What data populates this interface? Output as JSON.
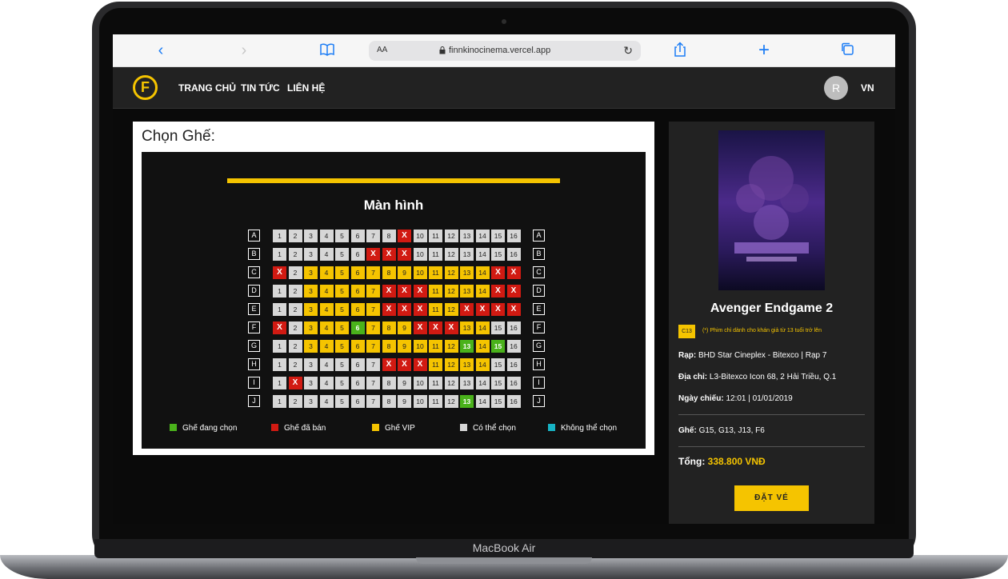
{
  "device": {
    "label": "MacBook Air"
  },
  "browser": {
    "url": "finnkinocinema.vercel.app",
    "text_size_label": "AA"
  },
  "header": {
    "logo_letter": "F",
    "nav": [
      "TRANG CHỦ",
      "TIN TỨC",
      "LIÊN HỆ"
    ],
    "avatar_initial": "R",
    "language": "VN"
  },
  "seat_panel": {
    "title": "Chọn Ghế:",
    "screen_label": "Màn hình",
    "rows": [
      {
        "label": "A",
        "seats": [
          "a",
          "a",
          "a",
          "a",
          "a",
          "a",
          "a",
          "a",
          "s",
          "a",
          "a",
          "a",
          "a",
          "a",
          "a",
          "a"
        ]
      },
      {
        "label": "B",
        "seats": [
          "a",
          "a",
          "a",
          "a",
          "a",
          "a",
          "s",
          "s",
          "s",
          "a",
          "a",
          "a",
          "a",
          "a",
          "a",
          "a"
        ]
      },
      {
        "label": "C",
        "seats": [
          "s",
          "a",
          "v",
          "v",
          "v",
          "v",
          "v",
          "v",
          "v",
          "v",
          "v",
          "v",
          "v",
          "v",
          "s",
          "s"
        ]
      },
      {
        "label": "D",
        "seats": [
          "a",
          "a",
          "v",
          "v",
          "v",
          "v",
          "v",
          "s",
          "s",
          "s",
          "v",
          "v",
          "v",
          "v",
          "s",
          "s"
        ]
      },
      {
        "label": "E",
        "seats": [
          "a",
          "a",
          "v",
          "v",
          "v",
          "v",
          "v",
          "s",
          "s",
          "s",
          "v",
          "v",
          "s",
          "s",
          "s",
          "s"
        ]
      },
      {
        "label": "F",
        "seats": [
          "s",
          "a",
          "v",
          "v",
          "v",
          "g",
          "v",
          "v",
          "v",
          "s",
          "s",
          "s",
          "v",
          "v",
          "a",
          "a"
        ]
      },
      {
        "label": "G",
        "seats": [
          "a",
          "a",
          "v",
          "v",
          "v",
          "v",
          "v",
          "v",
          "v",
          "v",
          "v",
          "v",
          "g",
          "v",
          "g",
          "a"
        ]
      },
      {
        "label": "H",
        "seats": [
          "a",
          "a",
          "a",
          "a",
          "a",
          "a",
          "a",
          "s",
          "s",
          "s",
          "v",
          "v",
          "v",
          "v",
          "a",
          "a"
        ]
      },
      {
        "label": "I",
        "seats": [
          "a",
          "s",
          "a",
          "a",
          "a",
          "a",
          "a",
          "a",
          "a",
          "a",
          "a",
          "a",
          "a",
          "a",
          "a",
          "a"
        ]
      },
      {
        "label": "J",
        "seats": [
          "a",
          "a",
          "a",
          "a",
          "a",
          "a",
          "a",
          "a",
          "a",
          "a",
          "a",
          "a",
          "g",
          "a",
          "a",
          "a"
        ]
      }
    ],
    "sold_mark": "X",
    "legend": [
      {
        "label": "Ghế đang chọn",
        "color": "#4ab21b"
      },
      {
        "label": "Ghế đã bán",
        "color": "#d11a12"
      },
      {
        "label": "Ghế VIP",
        "color": "#f5c400"
      },
      {
        "label": "Có thể chọn",
        "color": "#d7d7d7"
      },
      {
        "label": "Không thể chọn",
        "color": "#17b3c4"
      }
    ]
  },
  "booking": {
    "movie_title": "Avenger Endgame 2",
    "age_rating": "C13",
    "age_note": "(*) Phim chỉ dành cho khán giả từ 13 tuổi trở lên",
    "theater_label": "Rạp:",
    "theater_value": "BHD Star Cineplex - Bitexco | Rạp 7",
    "address_label": "Địa chỉ:",
    "address_value": "L3-Bitexco Icon 68, 2 Hải Triều, Q.1",
    "date_label": "Ngày chiếu:",
    "date_value": "12:01 | 01/01/2019",
    "seats_label": "Ghế:",
    "seats_value": "G15, G13, J13, F6",
    "total_label": "Tổng:",
    "total_value": "338.800 VNĐ",
    "button_label": "ĐẶT VÉ"
  },
  "colors": {
    "accent": "#f5c400",
    "sold": "#d11a12",
    "selected": "#4ab21b",
    "available": "#d7d7d7"
  }
}
